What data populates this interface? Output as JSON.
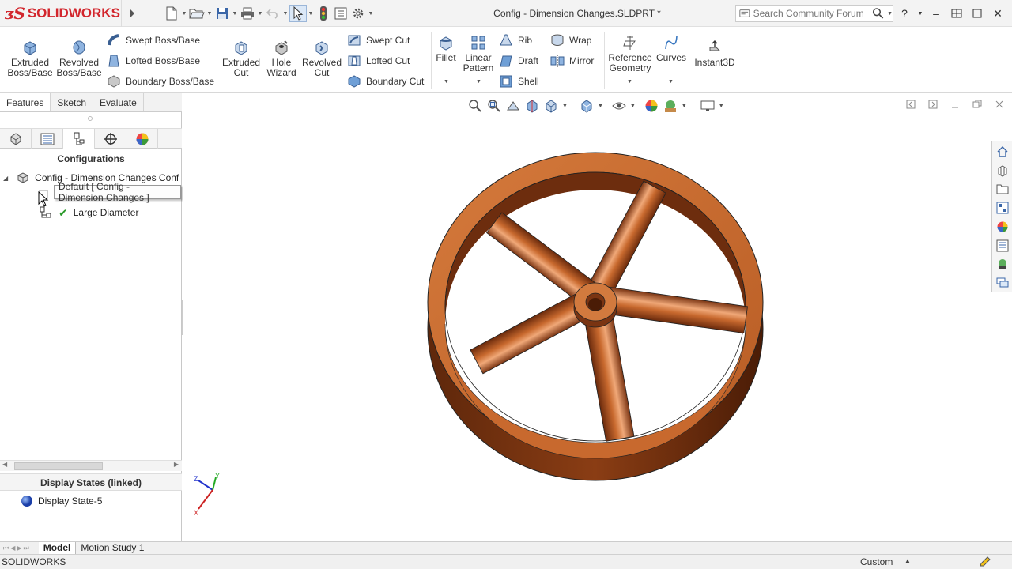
{
  "app": {
    "brand": "SOLIDWORKS",
    "window_title": "Config - Dimension Changes.SLDPRT *"
  },
  "search": {
    "placeholder": "Search Community Forum"
  },
  "ribbon": {
    "extruded_boss": "Extruded\nBoss/Base",
    "revolved_boss": "Revolved\nBoss/Base",
    "swept_boss": "Swept Boss/Base",
    "lofted_boss": "Lofted Boss/Base",
    "boundary_boss": "Boundary Boss/Base",
    "extruded_cut": "Extruded\nCut",
    "hole_wizard": "Hole\nWizard",
    "revolved_cut": "Revolved\nCut",
    "swept_cut": "Swept Cut",
    "lofted_cut": "Lofted Cut",
    "boundary_cut": "Boundary Cut",
    "fillet": "Fillet",
    "linear_pattern": "Linear\nPattern",
    "rib": "Rib",
    "draft": "Draft",
    "shell": "Shell",
    "wrap": "Wrap",
    "mirror": "Mirror",
    "reference_geometry": "Reference\nGeometry",
    "curves": "Curves",
    "instant3d": "Instant3D"
  },
  "tabs": {
    "features": "Features",
    "sketch": "Sketch",
    "evaluate": "Evaluate"
  },
  "config_panel": {
    "title": "Configurations",
    "root": "Config - Dimension Changes Conf",
    "tooltip": "Default [ Config - Dimension Changes ]",
    "items": [
      {
        "label": "Large Diameter"
      }
    ]
  },
  "display_states": {
    "title": "Display States (linked)",
    "item": "Display State-5"
  },
  "bottom_tabs": {
    "model": "Model",
    "motion": "Motion Study 1"
  },
  "status": {
    "left": "SOLIDWORKS",
    "units": "Custom"
  },
  "triad": {
    "x": "X",
    "y": "Y",
    "z": "Z"
  },
  "colors": {
    "brand_red": "#d2262d",
    "wheel": "#c8692e",
    "wheel_dark": "#7a3412"
  }
}
